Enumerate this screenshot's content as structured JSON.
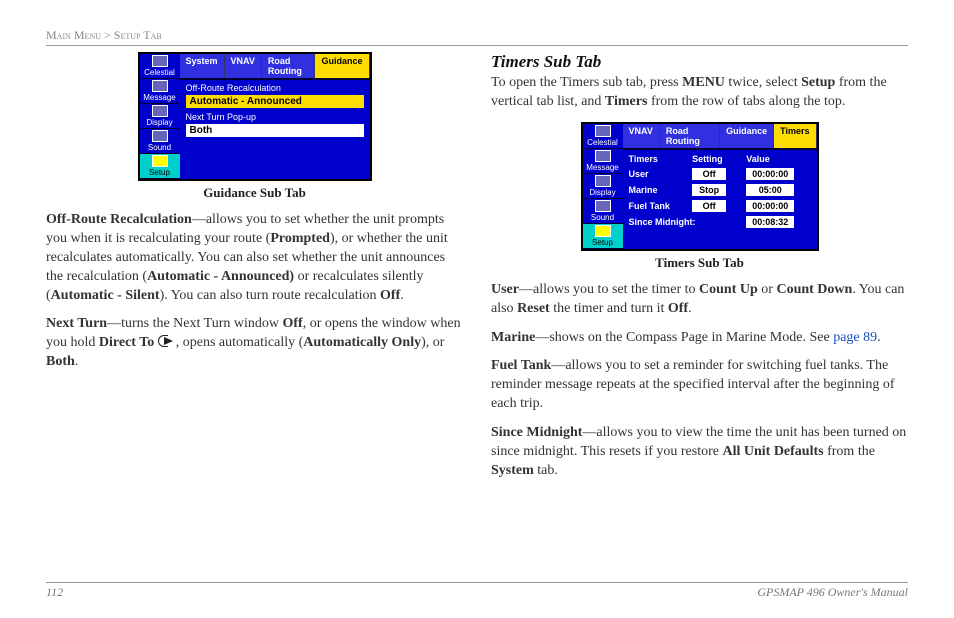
{
  "breadcrumb": {
    "section": "Main Menu >",
    "page": "Setup Tab"
  },
  "left": {
    "fig": {
      "caption": "Guidance Sub Tab",
      "sidebar": [
        "Celestial",
        "Message",
        "Display",
        "Sound",
        "Setup"
      ],
      "active_side": 4,
      "tabs": [
        "System",
        "VNAV",
        "Road Routing",
        "Guidance"
      ],
      "active_tab": 3,
      "field1_label": "Off-Route Recalculation",
      "field1_value": "Automatic - Announced",
      "field2_label": "Next Turn Pop-up",
      "field2_value": "Both"
    },
    "p1": {
      "b1": "Off-Route Recalculation",
      "t1": "—allows you to set whether the unit prompts you when it is recalculating your route (",
      "b2": "Prompted",
      "t2": "), or whether the unit recalculates automatically. You can also set whether the unit announces the recalculation (",
      "b3": "Automatic - Announced)",
      "t3": " or recalculates silently (",
      "b4": "Automatic - Silent",
      "t4": "). You can also turn route recalculation ",
      "b5": "Off",
      "t5": "."
    },
    "p2": {
      "b1": "Next Turn",
      "t1": "—turns the Next Turn window ",
      "b2": "Off",
      "t2": ", or opens the window when you hold ",
      "b3": "Direct To ",
      "t3": ", opens automatically (",
      "b4": "Automatically Only",
      "t4": "), or ",
      "b5": "Both",
      "t5": "."
    }
  },
  "right": {
    "heading": "Timers Sub Tab",
    "intro": {
      "t1": "To open the Timers sub tab, press ",
      "b1": "MENU",
      "t2": " twice, select ",
      "b2": "Setup",
      "t3": " from the vertical tab list, and ",
      "b3": "Timers",
      "t4": " from the row of tabs along the top."
    },
    "fig": {
      "caption": "Timers Sub Tab",
      "sidebar": [
        "Celestial",
        "Message",
        "Display",
        "Sound",
        "Setup"
      ],
      "active_side": 4,
      "tabs": [
        "VNAV",
        "Road Routing",
        "Guidance",
        "Timers"
      ],
      "active_tab": 3,
      "hdr": {
        "c1": "Timers",
        "c2": "Setting",
        "c3": "Value"
      },
      "rows": [
        {
          "label": "User",
          "setting": "Off",
          "value": "00:00:00"
        },
        {
          "label": "Marine",
          "setting": "Stop",
          "value": "05:00"
        },
        {
          "label": "Fuel Tank",
          "setting": "Off",
          "value": "00:00:00"
        }
      ],
      "since_label": "Since Midnight:",
      "since_value": "00:08:32"
    },
    "p1": {
      "b1": "User",
      "t1": "—allows you to set the timer to ",
      "b2": "Count Up",
      "t2": " or ",
      "b3": "Count Down",
      "t3": ". You can also ",
      "b4": "Reset",
      "t4": " the timer and turn it ",
      "b5": "Off",
      "t5": "."
    },
    "p2": {
      "b1": "Marine",
      "t1": "—shows on the Compass Page in Marine Mode. See ",
      "link": "page 89",
      "t2": "."
    },
    "p3": {
      "b1": "Fuel Tank",
      "t1": "—allows you to set a reminder for switching fuel tanks. The reminder message repeats at the specified interval after the beginning of each trip."
    },
    "p4": {
      "b1": "Since Midnight",
      "t1": "—allows you to view the time the unit has been turned on since midnight. This resets if you restore ",
      "b2": "All Unit Defaults",
      "t2": " from the ",
      "b3": "System",
      "t3": " tab."
    }
  },
  "footer": {
    "pageno": "112",
    "manual": "GPSMAP 496 Owner's Manual"
  }
}
